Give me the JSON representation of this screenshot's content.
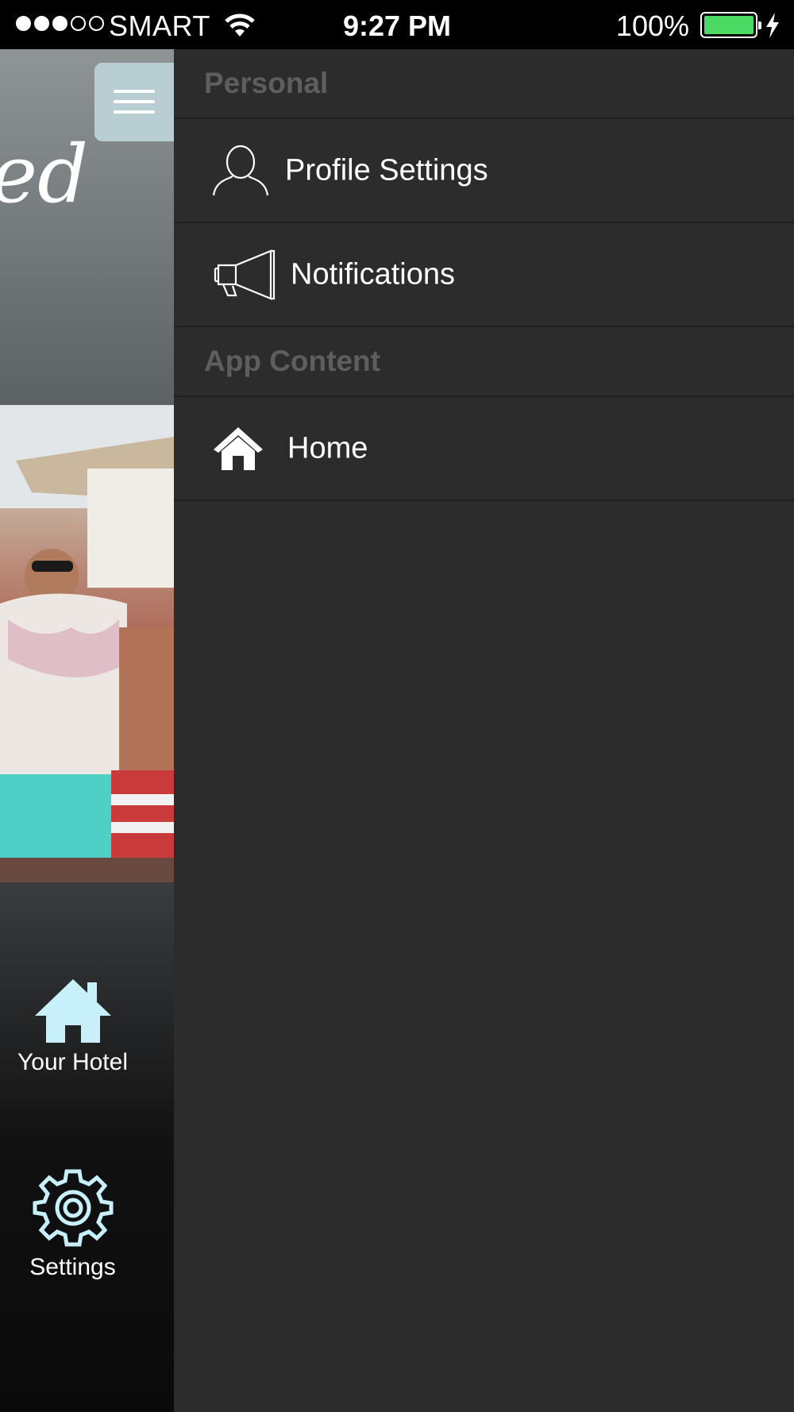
{
  "status_bar": {
    "carrier": "SMART",
    "time": "9:27 PM",
    "battery_percent": "100%",
    "signal_bars_filled": 3,
    "signal_bars_total": 5,
    "icons": [
      "wifi-icon",
      "battery-icon",
      "charging-bolt-icon"
    ]
  },
  "app_peek": {
    "title_fragment": "ed",
    "menu_icon": "hamburger-menu-icon",
    "dock": [
      {
        "label": "Your Hotel",
        "icon": "house-icon"
      },
      {
        "label": "Settings",
        "icon": "gear-icon"
      }
    ],
    "accent_color": "#c7f0fb"
  },
  "drawer": {
    "sections": [
      {
        "header": "Personal",
        "items": [
          {
            "label": "Profile Settings",
            "icon": "person-outline-icon"
          },
          {
            "label": "Notifications",
            "icon": "megaphone-icon"
          }
        ]
      },
      {
        "header": "App Content",
        "items": [
          {
            "label": "Home",
            "icon": "home-icon"
          }
        ]
      }
    ],
    "background_color": "#2c2c2c",
    "header_text_color": "#5e5e5e"
  }
}
